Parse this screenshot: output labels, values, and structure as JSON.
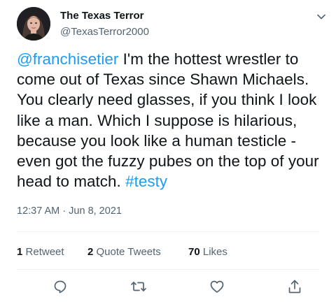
{
  "author": {
    "name": "The Texas Terror",
    "handle": "@TexasTerror2000"
  },
  "tweet": {
    "mention": "@franchisetier",
    "text": " I'm the hottest wrestler to come out of Texas since Shawn Michaels. You clearly need glasses, if you think I look like a man. Which I suppose is hilarious, because you look like a human testicle - even got the fuzzy pubes on the top of your head to match. ",
    "hashtag": "#testy",
    "time": "12:37 AM",
    "separator": " · ",
    "date": "Jun 8, 2021"
  },
  "stats": {
    "retweets_count": "1",
    "retweets_label": "Retweet",
    "quotes_count": "2",
    "quotes_label": "Quote Tweets",
    "likes_count": "70",
    "likes_label": "Likes"
  },
  "actions": [
    "reply-icon",
    "retweet-icon",
    "like-icon",
    "share-icon"
  ],
  "colors": {
    "link": "#1d9bf0",
    "secondary_text": "#536471",
    "primary_text": "#0f1419",
    "divider": "#eff3f4"
  }
}
